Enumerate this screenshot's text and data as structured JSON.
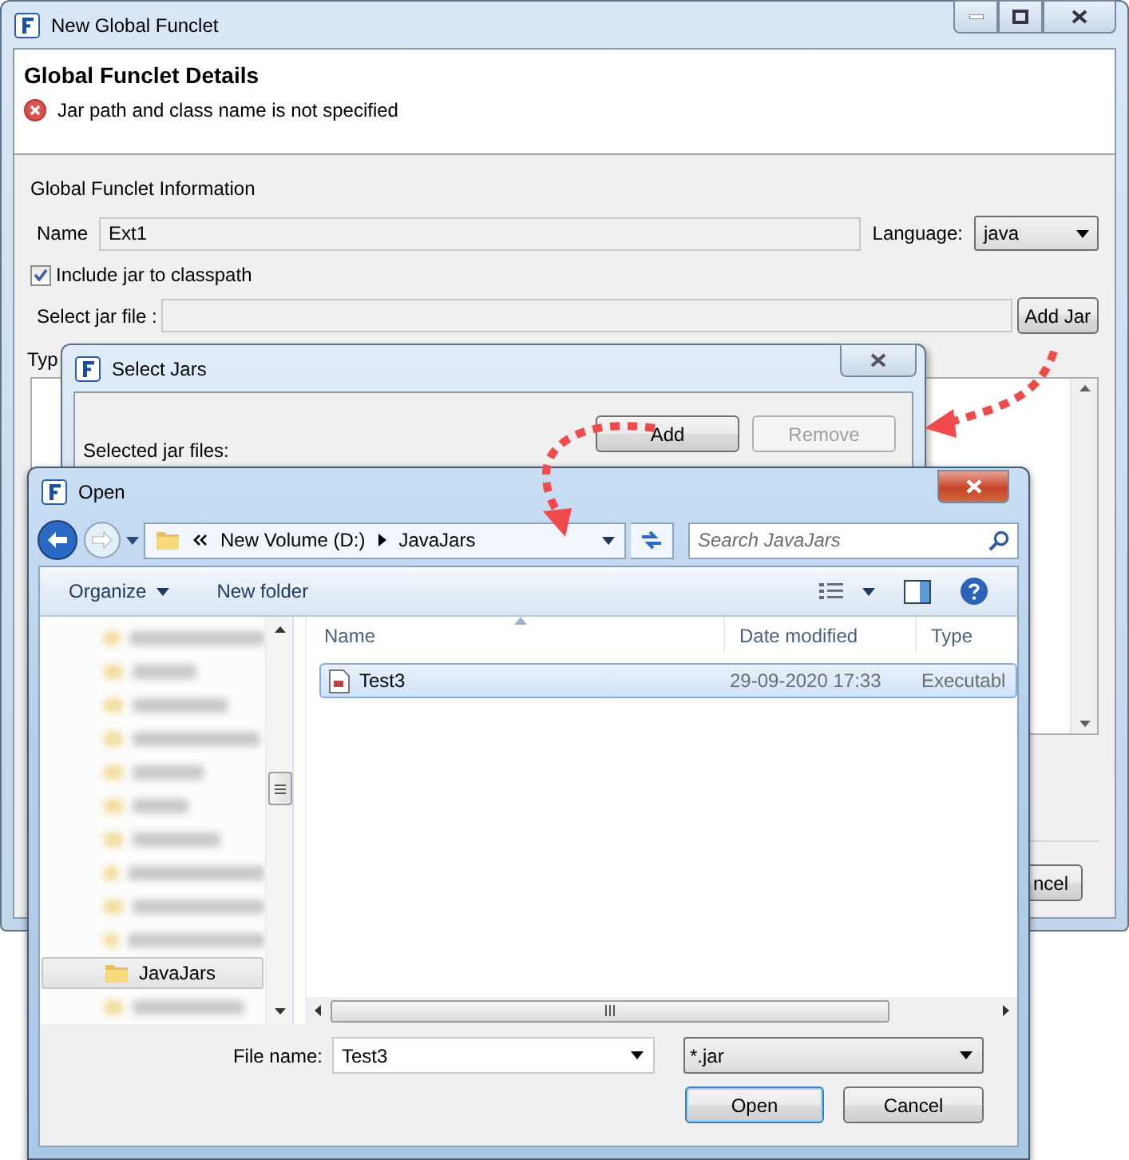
{
  "main_window": {
    "title": "New Global Funclet",
    "header_title": "Global Funclet Details",
    "error_message": "Jar path and class name is not specified",
    "section_title": "Global Funclet Information",
    "name_label": "Name",
    "name_value": "Ext1",
    "language_label": "Language:",
    "language_value": "java",
    "include_jar": {
      "label": "Include jar to classpath",
      "checked": true
    },
    "jar_file_label": "Select jar file :",
    "add_jar_button": "Add Jar",
    "type_label_partial": "Typ",
    "cancel_button_partial": "ncel"
  },
  "select_jars_window": {
    "title": "Select Jars",
    "selected_label": "Selected jar files:",
    "buttons": [
      {
        "label": "Add",
        "disabled": false
      },
      {
        "label": "Remove",
        "disabled": true
      }
    ]
  },
  "open_dialog": {
    "title": "Open",
    "breadcrumb": [
      "New Volume (D:)",
      "JavaJars"
    ],
    "search": {
      "placeholder": "Search JavaJars"
    },
    "toolbar": [
      "Organize",
      "New folder"
    ],
    "nav_items": [
      {
        "kind": "blurred",
        "selected": false
      },
      {
        "kind": "blurred",
        "selected": false
      },
      {
        "kind": "blurred",
        "selected": false
      },
      {
        "kind": "blurred",
        "selected": false
      },
      {
        "kind": "blurred",
        "selected": false
      },
      {
        "kind": "blurred",
        "selected": false
      },
      {
        "kind": "blurred",
        "selected": false
      },
      {
        "kind": "blurred",
        "selected": false
      },
      {
        "kind": "blurred",
        "selected": false
      },
      {
        "kind": "blurred",
        "selected": false
      },
      {
        "kind": "folder",
        "label": "JavaJars",
        "selected": true
      },
      {
        "kind": "blurred",
        "selected": false
      }
    ],
    "columns": [
      "Name",
      "Date modified",
      "Type"
    ],
    "files": [
      {
        "name": "Test3",
        "date": "29-09-2020 17:33",
        "type": "Executabl",
        "selected": true
      }
    ],
    "file_name_label": "File name:",
    "file_name_value": "Test3",
    "filter": "*.jar",
    "open_button": "Open",
    "cancel_button": "Cancel"
  }
}
